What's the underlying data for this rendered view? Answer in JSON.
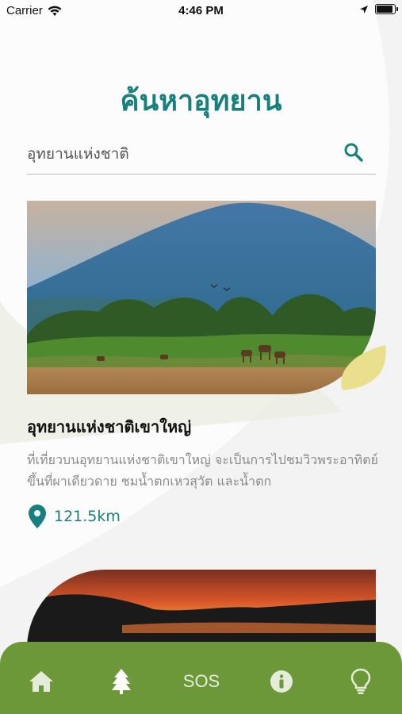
{
  "status_bar": {
    "carrier": "Carrier",
    "time": "4:46 PM",
    "battery_level": 0.9
  },
  "page": {
    "title": "ค้นหาอุทยาน"
  },
  "search": {
    "placeholder": "อุทยานแห่งชาติ",
    "value": ""
  },
  "cards": [
    {
      "name": "อุทยานแห่งชาติเขาใหญ่",
      "description": "ที่เที่ยวบนอุทยานแห่งชาติเขาใหญ่ จะเป็นการไปชมวิวพระอาทิตย์ขึ้นที่ผาเดียวดาย ชมน้ำตกเหวสุวัต และน้ำตก",
      "distance": "121.5km",
      "icon": "location-pin-icon"
    }
  ],
  "tab_bar": {
    "items": [
      {
        "icon": "home-icon"
      },
      {
        "icon": "tree-icon"
      },
      {
        "label": "SOS"
      },
      {
        "icon": "info-icon"
      },
      {
        "icon": "lightbulb-icon"
      }
    ]
  },
  "colors": {
    "accent": "#17807f",
    "tab_bar": "#6d983a",
    "background": "#f3f3f3"
  }
}
